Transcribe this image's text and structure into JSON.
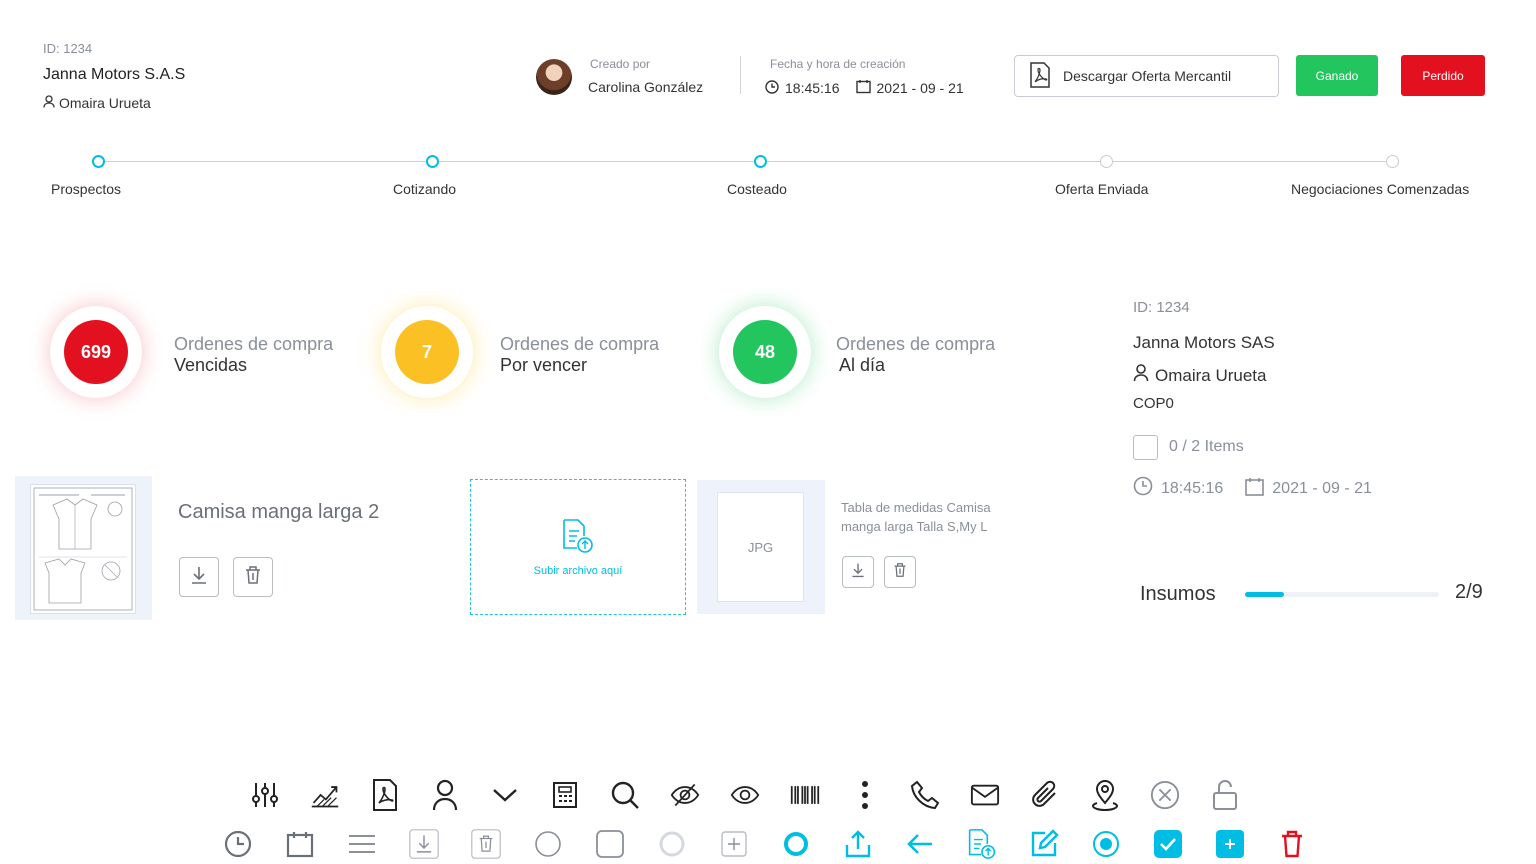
{
  "header": {
    "id_label": "ID: 1234",
    "company": "Janna Motors S.A.S",
    "user": "Omaira Urueta",
    "created_by_label": "Creado por",
    "created_by": "Carolina González",
    "datetime_label": "Fecha y hora de creación",
    "time": "18:45:16",
    "date": "2021 - 09 - 21",
    "download_label": "Descargar Oferta Mercantil",
    "won_label": "Ganado",
    "lost_label": "Perdido"
  },
  "stepper": {
    "steps": [
      {
        "label": "Prospectos",
        "active": true
      },
      {
        "label": "Cotizando",
        "active": true
      },
      {
        "label": "Costeado",
        "active": true
      },
      {
        "label": "Oferta Enviada",
        "active": false
      },
      {
        "label": "Negociaciones Comenzadas",
        "active": false
      }
    ]
  },
  "orders": [
    {
      "count": "699",
      "line1": "Ordenes de compra",
      "line2": "Vencidas",
      "color": "#e3101f"
    },
    {
      "count": "7",
      "line1": "Ordenes de compra",
      "line2": "Por vencer",
      "color": "#fbc124"
    },
    {
      "count": "48",
      "line1": "Ordenes de compra",
      "line2": "Al día",
      "color": "#22c55e"
    }
  ],
  "panel": {
    "id_label": "ID: 1234",
    "company": "Janna Motors SAS",
    "user": "Omaira Urueta",
    "currency": "COP0",
    "items": "0 / 2 Items",
    "time": "18:45:16",
    "date": "2021 - 09 - 21",
    "insumos_label": "Insumos",
    "insumos_value": "2/9",
    "insumos_progress": 0.2
  },
  "files": {
    "file_title": "Camisa manga larga 2",
    "upload_label": "Subir archivo aquí",
    "jpg_label": "JPG",
    "jpg_description": "Tabla de medidas Camisa manga larga Talla S,My L"
  },
  "colors": {
    "accent": "#00bde3",
    "success": "#22c55e",
    "danger": "#e3101f",
    "warning": "#fbc124"
  },
  "icon_library": {
    "row1": [
      "sliders-icon",
      "trend-chart-icon",
      "pdf-icon",
      "user-icon",
      "chevron-down-icon",
      "calculator-icon",
      "search-icon",
      "eye-off-icon",
      "eye-icon",
      "barcode-icon",
      "more-vertical-icon",
      "phone-icon",
      "mail-icon",
      "paperclip-icon",
      "location-pin-icon",
      "close-circle-icon",
      "unlock-icon"
    ],
    "row2": [
      "clock-icon",
      "calendar-icon",
      "menu-icon",
      "download-icon",
      "trash-icon",
      "radio-empty-icon",
      "checkbox-empty-icon",
      "radio-disabled-icon",
      "add-small-icon",
      "ring-icon",
      "upload-icon",
      "arrow-left-icon",
      "file-upload-icon",
      "edit-icon",
      "radio-selected-icon",
      "checkbox-checked-icon",
      "plus-square-icon",
      "trash-red-icon"
    ]
  }
}
